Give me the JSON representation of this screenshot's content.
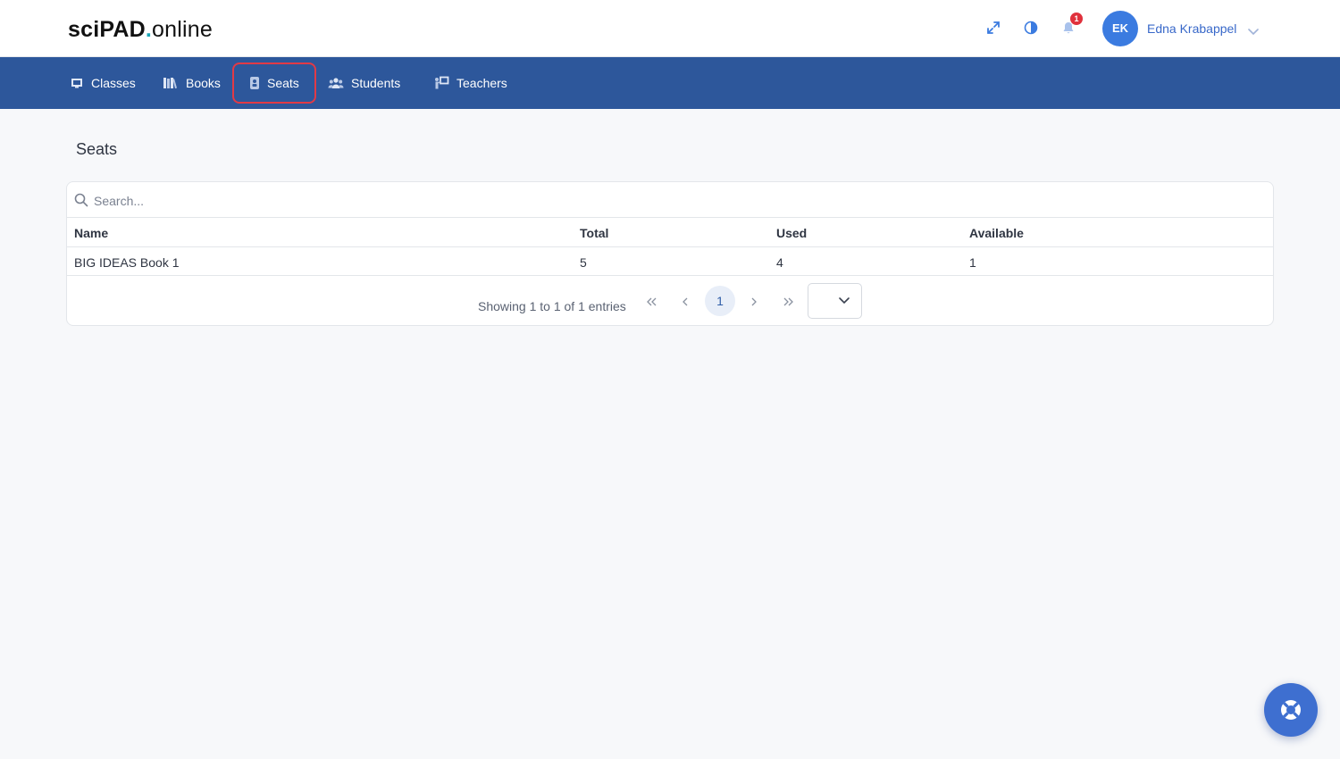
{
  "header": {
    "logo": {
      "part1": "sciPAD",
      "part2": ".",
      "part3": "online"
    },
    "icons": [
      "expand-icon",
      "contrast-icon",
      "bell-icon"
    ],
    "notification_count": "1",
    "user": {
      "initials": "EK",
      "name": "Edna Krabappel"
    }
  },
  "nav": {
    "items": [
      {
        "label": "Classes",
        "icon": "classes-icon"
      },
      {
        "label": "Books",
        "icon": "books-icon"
      },
      {
        "label": "Seats",
        "icon": "seat-icon",
        "active": true
      },
      {
        "label": "Students",
        "icon": "students-icon"
      },
      {
        "label": "Teachers",
        "icon": "teachers-icon"
      }
    ]
  },
  "page": {
    "title": "Seats"
  },
  "table": {
    "search_placeholder": "Search...",
    "columns": [
      "Name",
      "Total",
      "Used",
      "Available"
    ],
    "rows": [
      [
        "BIG IDEAS Book 1",
        "5",
        "4",
        "1"
      ]
    ]
  },
  "pagination": {
    "summary": "Showing 1 to 1 of 1 entries",
    "current_page": "1",
    "page_size": ""
  },
  "colors": {
    "navbar": "#2d579b",
    "accent": "#3b7be0",
    "active_outline": "#e13a46",
    "badge": "#e0313c",
    "logo_dot": "#1aa6b7"
  }
}
